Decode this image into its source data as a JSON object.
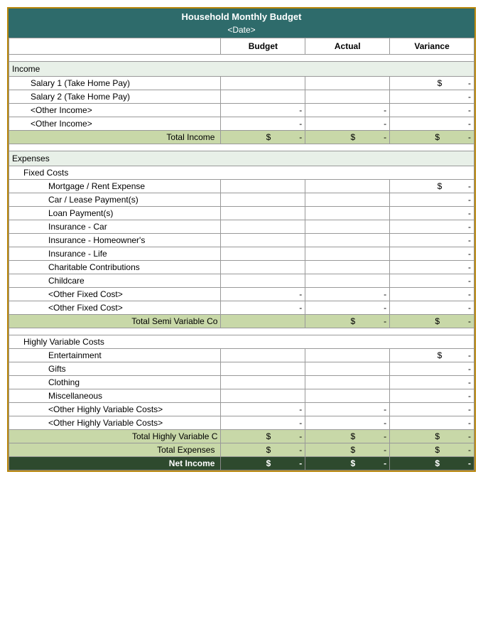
{
  "header": {
    "title": "Household Monthly Budget",
    "date": "<Date>"
  },
  "columns": {
    "budget": "Budget",
    "actual": "Actual",
    "variance": "Variance"
  },
  "income": {
    "label": "Income",
    "rows": [
      {
        "label": "Salary 1 (Take Home Pay)",
        "budget": "",
        "actual": "",
        "variance_prefix": "$",
        "variance": "-"
      },
      {
        "label": "Salary 2 (Take Home Pay)",
        "budget": "",
        "actual": "",
        "variance_prefix": "",
        "variance": "-"
      },
      {
        "label": "<Other Income>",
        "budget": "-",
        "actual": "-",
        "variance_prefix": "",
        "variance": "-"
      },
      {
        "label": "<Other Income>",
        "budget": "-",
        "actual": "-",
        "variance_prefix": "",
        "variance": "-"
      }
    ],
    "total_label": "Total Income",
    "total_budget_prefix": "$",
    "total_budget": "-",
    "total_actual_prefix": "$",
    "total_actual": "-",
    "total_variance_prefix": "$",
    "total_variance": "-"
  },
  "expenses": {
    "label": "Expenses",
    "fixed_costs": {
      "label": "Fixed Costs",
      "rows": [
        {
          "label": "Mortgage / Rent Expense",
          "budget": "",
          "actual": "",
          "variance_prefix": "$",
          "variance": "-"
        },
        {
          "label": "Car / Lease Payment(s)",
          "budget": "",
          "actual": "",
          "variance_prefix": "",
          "variance": "-"
        },
        {
          "label": "Loan Payment(s)",
          "budget": "",
          "actual": "",
          "variance_prefix": "",
          "variance": "-"
        },
        {
          "label": "Insurance - Car",
          "budget": "",
          "actual": "",
          "variance_prefix": "",
          "variance": "-"
        },
        {
          "label": "Insurance - Homeowner's",
          "budget": "",
          "actual": "",
          "variance_prefix": "",
          "variance": "-"
        },
        {
          "label": "Insurance - Life",
          "budget": "",
          "actual": "",
          "variance_prefix": "",
          "variance": "-"
        },
        {
          "label": "Charitable Contributions",
          "budget": "",
          "actual": "",
          "variance_prefix": "",
          "variance": "-"
        },
        {
          "label": "Childcare",
          "budget": "",
          "actual": "",
          "variance_prefix": "",
          "variance": "-"
        },
        {
          "label": "<Other Fixed Cost>",
          "budget": "-",
          "actual": "-",
          "variance_prefix": "",
          "variance": "-"
        },
        {
          "label": "<Other Fixed Cost>",
          "budget": "-",
          "actual": "-",
          "variance_prefix": "",
          "variance": "-"
        }
      ],
      "total_label": "Total Semi Variable Co",
      "total_budget_prefix": "",
      "total_budget": "",
      "total_actual_prefix": "$",
      "total_actual": "-",
      "total_variance_prefix": "$",
      "total_variance": "-"
    },
    "variable_costs": {
      "label": "Highly Variable Costs",
      "rows": [
        {
          "label": "Entertainment",
          "budget": "",
          "actual": "",
          "variance_prefix": "$",
          "variance": "-"
        },
        {
          "label": "Gifts",
          "budget": "",
          "actual": "",
          "variance_prefix": "",
          "variance": "-"
        },
        {
          "label": "Clothing",
          "budget": "",
          "actual": "",
          "variance_prefix": "",
          "variance": "-"
        },
        {
          "label": "Miscellaneous",
          "budget": "",
          "actual": "",
          "variance_prefix": "",
          "variance": "-"
        },
        {
          "label": "<Other Highly Variable Costs>",
          "budget": "-",
          "actual": "-",
          "variance_prefix": "",
          "variance": "-"
        },
        {
          "label": "<Other Highly Variable Costs>",
          "budget": "-",
          "actual": "-",
          "variance_prefix": "",
          "variance": "-"
        }
      ],
      "total_hv_label": "Total Highly Variable C",
      "total_hv_budget_prefix": "$",
      "total_hv_budget": "-",
      "total_hv_actual_prefix": "$",
      "total_hv_actual": "-",
      "total_hv_variance_prefix": "$",
      "total_hv_variance": "-",
      "total_exp_label": "Total Expenses",
      "total_exp_budget_prefix": "$",
      "total_exp_budget": "-",
      "total_exp_actual_prefix": "$",
      "total_exp_actual": "-",
      "total_exp_variance_prefix": "$",
      "total_exp_variance": "-"
    },
    "net_income": {
      "label": "Net Income",
      "budget_prefix": "$",
      "budget": "-",
      "actual_prefix": "$",
      "actual": "-",
      "variance_prefix": "$",
      "variance": "-"
    }
  }
}
